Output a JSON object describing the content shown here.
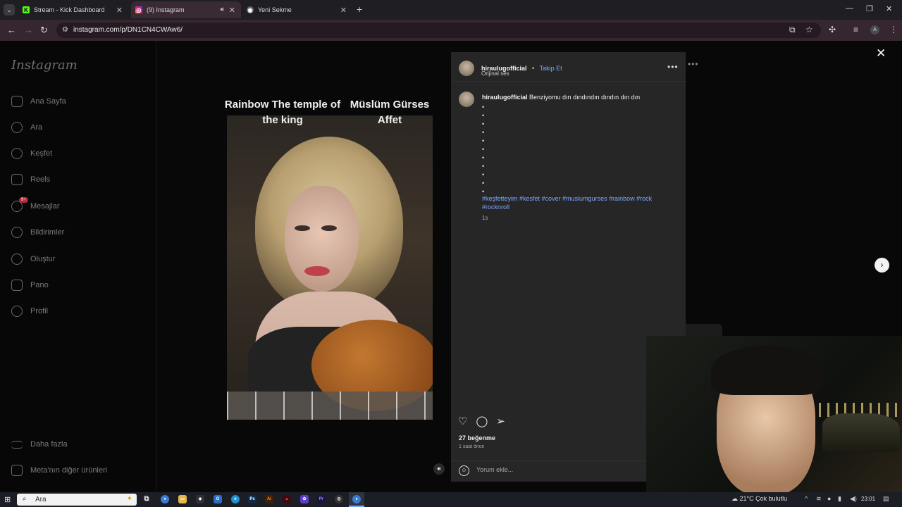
{
  "browser": {
    "tabs": [
      {
        "title": "Stream - Kick Dashboard",
        "favicon": "kick-icon"
      },
      {
        "title": "(9) Instagram",
        "favicon": "instagram-icon"
      },
      {
        "title": "Yeni Sekme",
        "favicon": "chrome-icon"
      }
    ],
    "new_tab": "+",
    "url": "instagram.com/p/DN1CN4CWAw6/",
    "profile_initial": "A"
  },
  "sidebar": {
    "logo": "Instagram",
    "items": [
      {
        "label": "Ana Sayfa",
        "icon": "home-icon"
      },
      {
        "label": "Ara",
        "icon": "search-icon"
      },
      {
        "label": "Keşfet",
        "icon": "compass-icon"
      },
      {
        "label": "Reels",
        "icon": "reels-icon"
      },
      {
        "label": "Mesajlar",
        "icon": "messenger-icon",
        "badge": "9+"
      },
      {
        "label": "Bildirimler",
        "icon": "heart-icon"
      },
      {
        "label": "Oluştur",
        "icon": "plus-icon"
      },
      {
        "label": "Pano",
        "icon": "dashboard-icon"
      },
      {
        "label": "Profil",
        "icon": "profile-icon"
      }
    ],
    "more": "Daha fazla",
    "meta": "Meta'nın diğer ürünleri"
  },
  "video": {
    "caption_left": "Rainbow The temple of the king",
    "caption_right": "Müslüm Gürses Affet"
  },
  "post": {
    "username": "hiraulugofficial",
    "separator": "•",
    "follow": "Takip Et",
    "audio": "Orijinal ses",
    "caption": "Benziyomu dın dındındın dındın dın dın",
    "dots": "•\n•\n•\n•\n•\n•\n•\n•\n•\n•\n•",
    "hashtags": "#keşfetteyim #kesfet #cover #muslumgurses #rainbow #rock #rocknroll",
    "time_ago": "1s",
    "likes": "27 beğenme",
    "posted": "1 saat önce",
    "comment_placeholder": "Yorum ekle..."
  },
  "background": {
    "logo_letter": "M"
  },
  "taskbar": {
    "search": "Ara",
    "weather": "21°C  Çok bulutlu",
    "time": "23:01"
  },
  "colors": {
    "accent_link": "#7aa7ff",
    "modal_bg": "#262626",
    "badge": "#b3263c"
  }
}
